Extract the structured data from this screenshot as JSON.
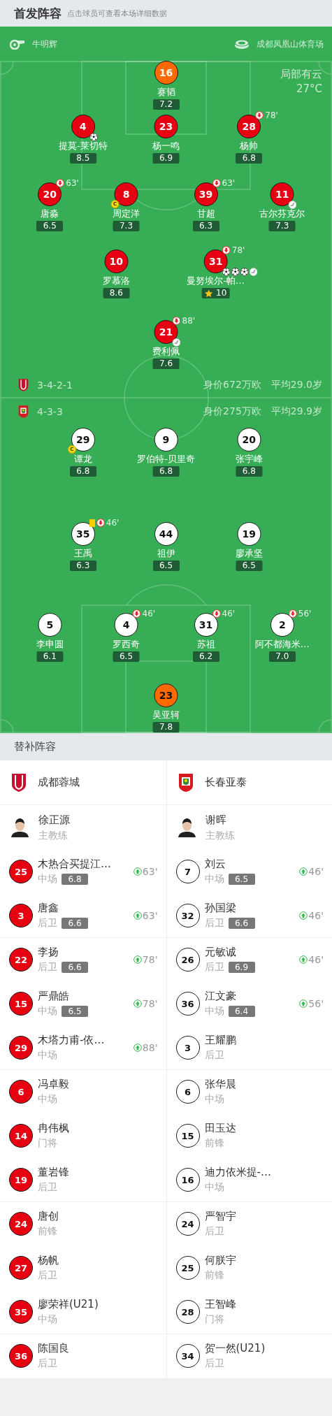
{
  "header": {
    "title": "首发阵容",
    "subtitle": "点击球员可查看本场详细数据"
  },
  "match_info": {
    "referee": "牛明辉",
    "stadium": "成都凤凰山体育场",
    "weather": "局部有云",
    "temperature": "27°C"
  },
  "home": {
    "kind": "home",
    "formation": "3-4-2-1",
    "value": "身价672万欧",
    "avg_age": "平均29.0岁",
    "lines": [
      [
        {
          "number": "16",
          "name": "赛韬",
          "rating": "7.2",
          "kind": "keeper",
          "mvp": false
        }
      ],
      [
        {
          "number": "4",
          "name": "提莫-莱切特",
          "rating": "8.5",
          "kind": "outfield",
          "mvp": false,
          "badges": [
            {
              "kind": "goal"
            }
          ]
        },
        {
          "number": "23",
          "name": "杨一鸣",
          "rating": "6.9",
          "kind": "outfield",
          "mvp": false
        },
        {
          "number": "28",
          "name": "杨帅",
          "rating": "6.8",
          "kind": "outfield",
          "mvp": false,
          "sub_out": "78'"
        }
      ],
      [
        {
          "number": "20",
          "name": "唐淼",
          "rating": "6.5",
          "kind": "outfield",
          "mvp": false,
          "sub_out": "63'"
        },
        {
          "number": "8",
          "name": "周定洋",
          "rating": "7.3",
          "kind": "outfield",
          "mvp": false,
          "badges": [
            {
              "kind": "captain",
              "text": "C"
            }
          ]
        },
        {
          "number": "39",
          "name": "甘超",
          "rating": "6.3",
          "kind": "outfield",
          "mvp": false,
          "sub_out": "63'"
        },
        {
          "number": "11",
          "name": "古尔芬克尔",
          "rating": "7.3",
          "kind": "outfield",
          "mvp": false,
          "badges": [
            {
              "kind": "assist"
            }
          ]
        }
      ],
      [
        {
          "number": "10",
          "name": "罗慕洛",
          "rating": "8.6",
          "kind": "outfield",
          "mvp": false
        },
        {
          "number": "31",
          "name": "曼努埃尔-帕…",
          "rating": "10",
          "kind": "outfield",
          "mvp": true,
          "sub_out": "78'",
          "badges": [
            {
              "kind": "goal"
            },
            {
              "kind": "goal"
            },
            {
              "kind": "goal"
            },
            {
              "kind": "assist"
            }
          ]
        }
      ],
      [
        {
          "number": "21",
          "name": "费利佩",
          "rating": "7.6",
          "kind": "outfield",
          "mvp": false,
          "sub_out": "88'",
          "badges": [
            {
              "kind": "assist"
            }
          ]
        }
      ]
    ]
  },
  "away": {
    "kind": "away",
    "formation": "4-3-3",
    "value": "身价275万欧",
    "avg_age": "平均29.9岁",
    "lines": [
      [
        {
          "number": "29",
          "name": "谭龙",
          "rating": "6.8",
          "kind": "outfield",
          "mvp": false,
          "badges": [
            {
              "kind": "captain",
              "text": "C"
            }
          ]
        },
        {
          "number": "9",
          "name": "罗伯特-贝里奇",
          "rating": "6.8",
          "kind": "outfield",
          "mvp": false
        },
        {
          "number": "20",
          "name": "张宇峰",
          "rating": "6.8",
          "kind": "outfield",
          "mvp": false
        }
      ],
      [
        {
          "number": "35",
          "name": "王禹",
          "rating": "6.3",
          "kind": "outfield",
          "mvp": false,
          "sub_out": "46'",
          "badges": [
            {
              "kind": "yellow_card"
            }
          ]
        },
        {
          "number": "44",
          "name": "祖伊",
          "rating": "6.5",
          "kind": "outfield",
          "mvp": false
        },
        {
          "number": "19",
          "name": "廖承坚",
          "rating": "6.5",
          "kind": "outfield",
          "mvp": false
        }
      ],
      [
        {
          "number": "5",
          "name": "李申圆",
          "rating": "6.1",
          "kind": "outfield",
          "mvp": false
        },
        {
          "number": "4",
          "name": "罗西奇",
          "rating": "6.5",
          "kind": "outfield",
          "mvp": false,
          "sub_out": "46'"
        },
        {
          "number": "31",
          "name": "苏祖",
          "rating": "6.2",
          "kind": "outfield",
          "mvp": false,
          "sub_out": "46'"
        },
        {
          "number": "2",
          "name": "阿不都海米…",
          "rating": "7.0",
          "kind": "outfield",
          "mvp": false,
          "sub_out": "56'"
        }
      ],
      [
        {
          "number": "23",
          "name": "吴亚轲",
          "rating": "7.8",
          "kind": "keeper",
          "mvp": false
        }
      ]
    ]
  },
  "subs_title": "替补阵容",
  "bench": [
    {
      "kind": "home",
      "team": "成都蓉城",
      "coach": "徐正源",
      "coach_role": "主教练",
      "players": [
        {
          "number": "25",
          "name": "木热合买提江…",
          "position": "中场",
          "rating": "6.8",
          "sub_in": "63'"
        },
        {
          "number": "3",
          "name": "唐鑫",
          "position": "后卫",
          "rating": "6.6",
          "sub_in": "63'"
        },
        {
          "number": "22",
          "name": "李扬",
          "position": "后卫",
          "rating": "6.6",
          "sub_in": "78'"
        },
        {
          "number": "15",
          "name": "严鼎皓",
          "position": "中场",
          "rating": "6.5",
          "sub_in": "78'"
        },
        {
          "number": "29",
          "name": "木塔力甫-依…",
          "position": "中场",
          "sub_in": "88'"
        },
        {
          "number": "6",
          "name": "冯卓毅",
          "position": "中场"
        },
        {
          "number": "14",
          "name": "冉伟枫",
          "position": "门将"
        },
        {
          "number": "19",
          "name": "董岩锋",
          "position": "后卫"
        },
        {
          "number": "24",
          "name": "唐创",
          "position": "前锋"
        },
        {
          "number": "27",
          "name": "杨帆",
          "position": "后卫"
        },
        {
          "number": "35",
          "name": "廖荣祥(U21)",
          "position": "中场"
        },
        {
          "number": "36",
          "name": "陈国良",
          "position": "后卫"
        }
      ]
    },
    {
      "kind": "away",
      "team": "长春亚泰",
      "coach": "谢晖",
      "coach_role": "主教练",
      "players": [
        {
          "number": "7",
          "name": "刘云",
          "position": "中场",
          "rating": "6.5",
          "sub_in": "46'"
        },
        {
          "number": "32",
          "name": "孙国梁",
          "position": "后卫",
          "rating": "6.6",
          "sub_in": "46'"
        },
        {
          "number": "26",
          "name": "元敏诚",
          "position": "后卫",
          "rating": "6.9",
          "sub_in": "46'"
        },
        {
          "number": "36",
          "name": "江文豪",
          "position": "中场",
          "rating": "6.4",
          "sub_in": "56'"
        },
        {
          "number": "3",
          "name": "王耀鹏",
          "position": "后卫"
        },
        {
          "number": "6",
          "name": "张华晨",
          "position": "中场"
        },
        {
          "number": "15",
          "name": "田玉达",
          "position": "前锋"
        },
        {
          "number": "16",
          "name": "迪力依米提-…",
          "position": "中场"
        },
        {
          "number": "24",
          "name": "严智宇",
          "position": "后卫"
        },
        {
          "number": "25",
          "name": "何朕宇",
          "position": "前锋"
        },
        {
          "number": "28",
          "name": "王智峰",
          "position": "门将"
        },
        {
          "number": "34",
          "name": "贺一然(U21)",
          "position": "后卫"
        }
      ]
    }
  ]
}
